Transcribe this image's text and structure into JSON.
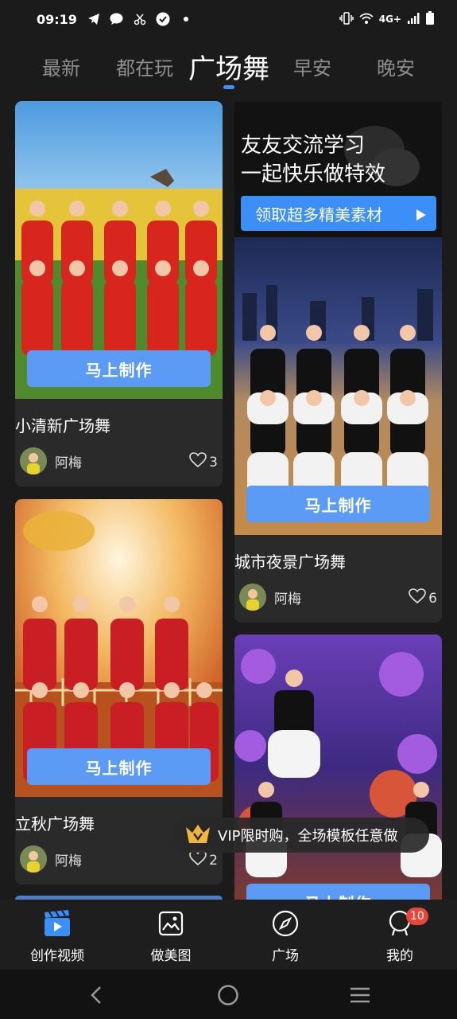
{
  "status_bar": {
    "time": "09:19",
    "network": "4G+"
  },
  "tabs": [
    {
      "label": "最新"
    },
    {
      "label": "都在玩"
    },
    {
      "label": "广场舞",
      "active": true
    },
    {
      "label": "早安"
    },
    {
      "label": "晚安"
    }
  ],
  "ad": {
    "line1": "友友交流学习",
    "line2": "一起快乐做特效",
    "button": "领取超多精美素材"
  },
  "cards": [
    {
      "title": "小清新广场舞",
      "author": "阿梅",
      "likes": "3",
      "button": "马上制作"
    },
    {
      "title": "城市夜景广场舞",
      "author": "阿梅",
      "likes": "6",
      "button": "马上制作"
    },
    {
      "title": "立秋广场舞",
      "author": "阿梅",
      "likes": "2",
      "button": "马上制作"
    },
    {
      "button": "马上制作"
    }
  ],
  "vip_banner": {
    "text": "VIP限时购，全场模板任意做"
  },
  "bottom_nav": [
    {
      "label": "创作视频",
      "icon": "video-clapper-icon",
      "active": true
    },
    {
      "label": "做美图",
      "icon": "image-icon"
    },
    {
      "label": "广场",
      "icon": "compass-icon"
    },
    {
      "label": "我的",
      "icon": "profile-icon",
      "badge": "10"
    }
  ],
  "colors": {
    "accent": "#3b8ff7",
    "button": "#5b9bf6",
    "badge": "#e9453b",
    "background": "#1b1b1b",
    "card": "#2a2a2a"
  }
}
